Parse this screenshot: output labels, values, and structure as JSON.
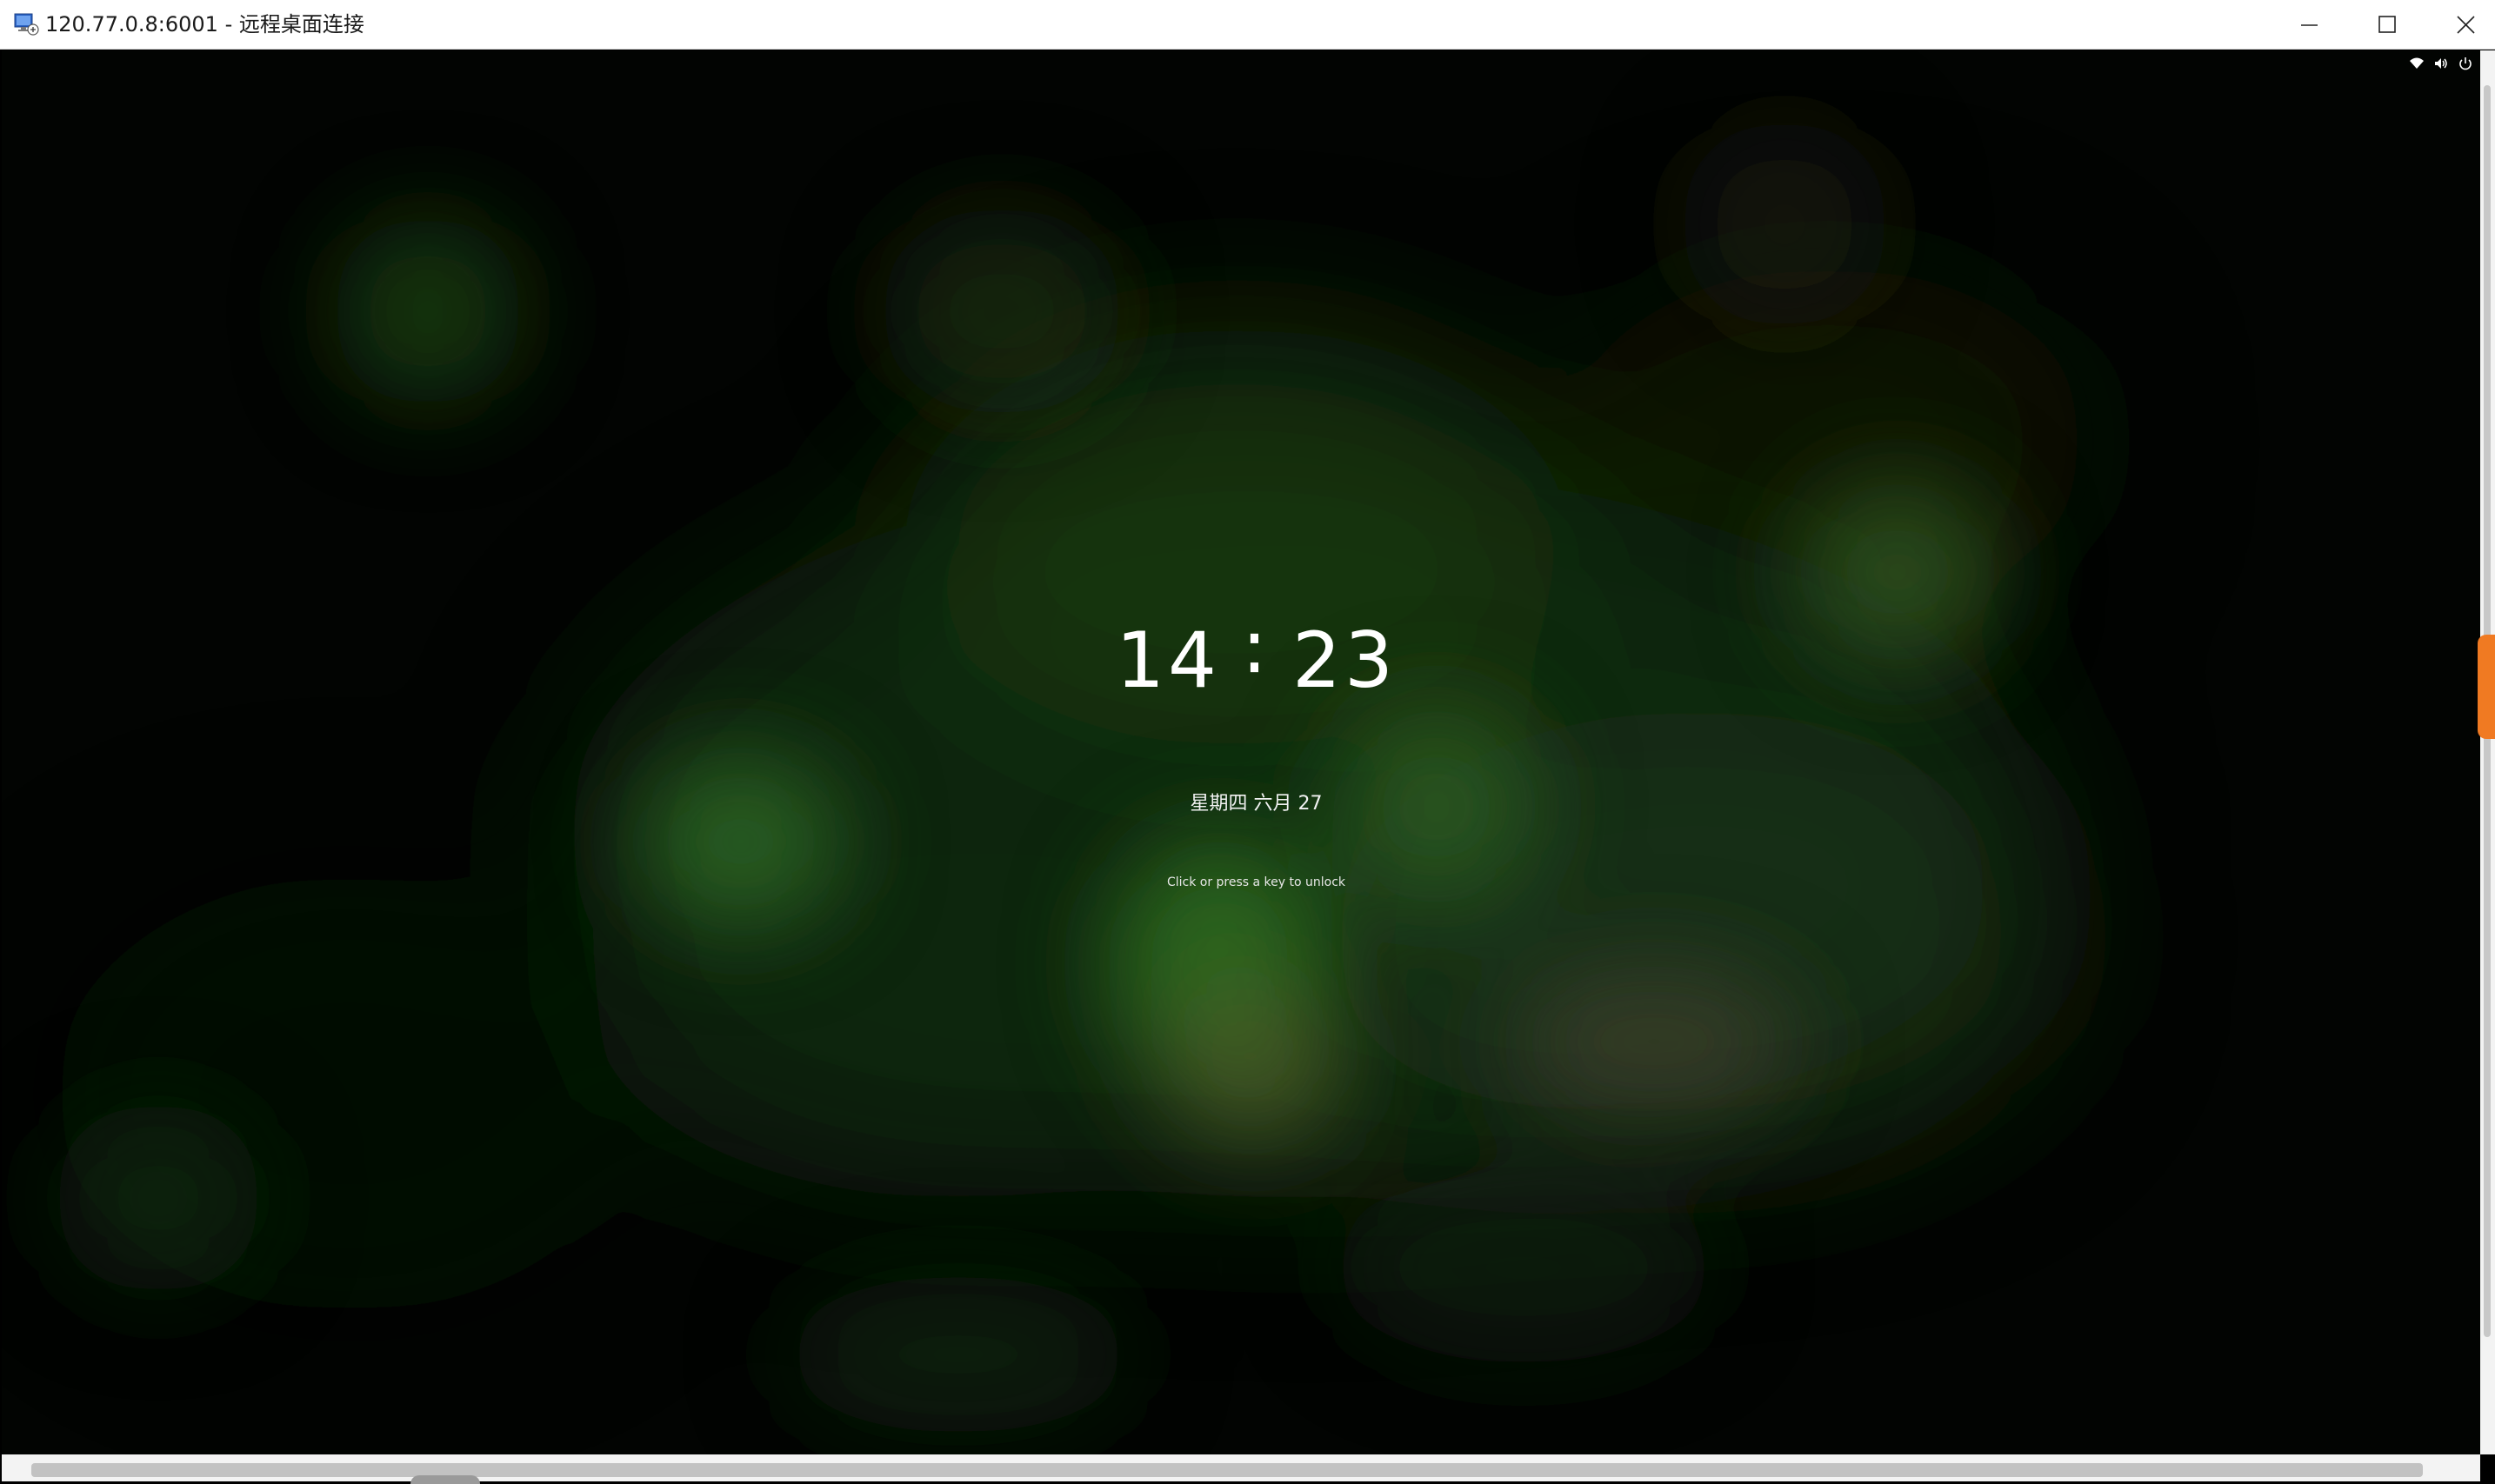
{
  "window": {
    "title": "120.77.0.8:6001 - 远程桌面连接",
    "icon": "remote-desktop-icon",
    "controls": {
      "minimize_icon": "minimize-icon",
      "maximize_icon": "maximize-icon",
      "close_icon": "close-icon"
    }
  },
  "remote": {
    "tray": {
      "icons": [
        "wifi-icon",
        "volume-icon",
        "power-icon"
      ]
    },
    "lockscreen": {
      "hour": "14",
      "separator": "∶",
      "minute": "23",
      "date": "星期四 六月 27",
      "hint": "Click or press a key to unlock"
    }
  },
  "colors": {
    "titlebar_bg": "#ffffff",
    "scroll_handle_accent": "#f07a22",
    "wallpaper_base": "#020402",
    "wallpaper_glow": "#2d6a1f"
  }
}
